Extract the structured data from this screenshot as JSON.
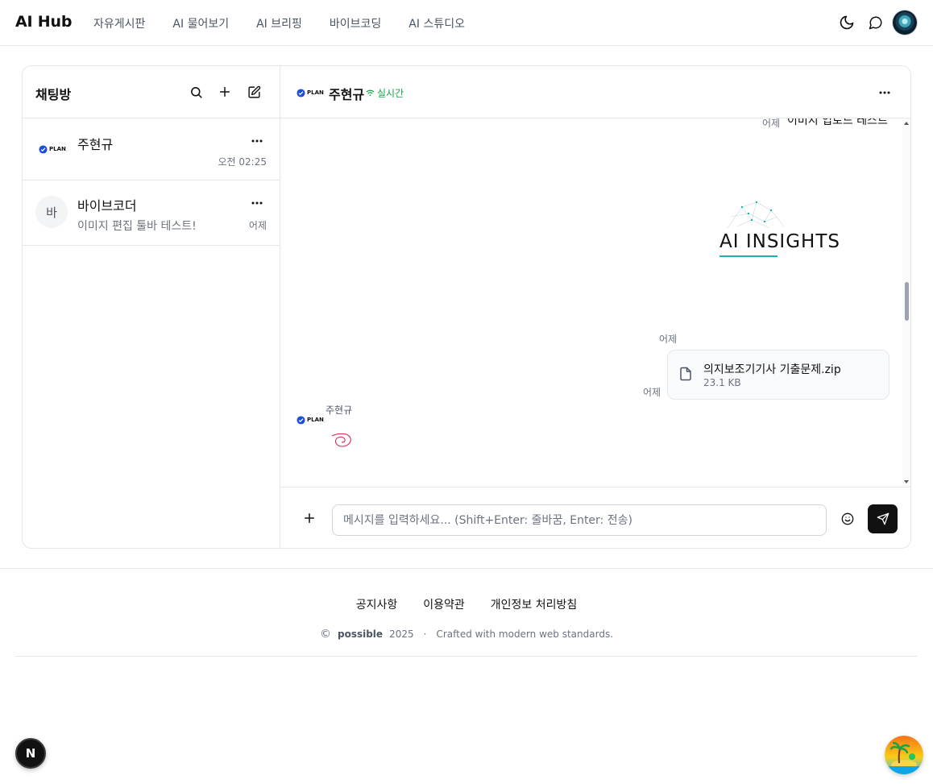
{
  "header": {
    "brand": "AI Hub",
    "nav": [
      "자유게시판",
      "AI 물어보기",
      "AI 브리핑",
      "바이브코딩",
      "AI 스튜디오"
    ]
  },
  "sidebar": {
    "title": "채팅방",
    "rooms": [
      {
        "name": "주현규",
        "preview": "",
        "time": "오전 02:25",
        "avatar": "PLAN"
      },
      {
        "name": "바이브코더",
        "preview": "이미지 편집 툴바 테스트!",
        "time": "어제",
        "avatar": "바"
      }
    ]
  },
  "chat": {
    "name": "주현규",
    "status": "실시간",
    "avatar": "PLAN",
    "messages": {
      "top_time": "어제",
      "top_text": "이미지 업로드 테스트",
      "image_time": "어제",
      "image_text": "AI INSIGHTS",
      "file_time": "어제",
      "file_name": "의지보조기기사 기출문제.zip",
      "file_size": "23.1 KB",
      "sender": "주현규"
    },
    "composer_placeholder": "메시지를 입력하세요... (Shift+Enter: 줄바꿈, Enter: 전송)"
  },
  "footer": {
    "links": [
      "공지사항",
      "이용약관",
      "개인정보 처리방침"
    ],
    "copyright_symbol": "©",
    "brand": "possible",
    "year": "2025",
    "separator": "·",
    "tagline": "Crafted with modern web standards."
  },
  "dev_badge": "N",
  "colors": {
    "live": "#16a34a",
    "accent": "#111111",
    "plan_blue": "#1d4ed8"
  }
}
